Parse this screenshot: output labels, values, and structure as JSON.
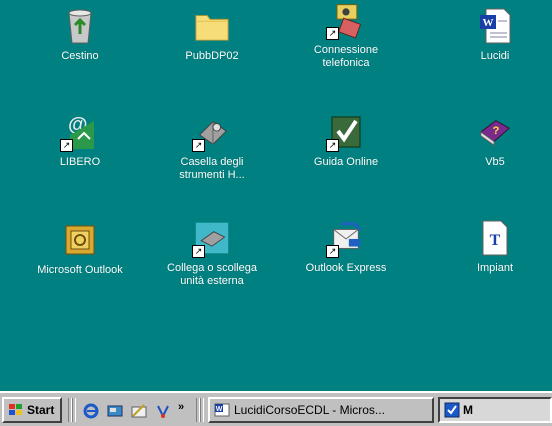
{
  "desktop": {
    "background_color": "#008080",
    "icons": [
      {
        "name": "Cestino",
        "icon": "recycle-bin-icon"
      },
      {
        "name": "PubbDP02",
        "icon": "folder-icon"
      },
      {
        "name": "Connessione telefonica",
        "icon": "dial-up-icon"
      },
      {
        "name": "Lucidi",
        "icon": "word-document-icon"
      },
      {
        "name": "LIBERO",
        "icon": "libero-icon"
      },
      {
        "name": "Casella degli strumenti H...",
        "icon": "toolbox-icon"
      },
      {
        "name": "Guida Online",
        "icon": "online-guide-icon"
      },
      {
        "name": "Vb5",
        "icon": "help-book-icon"
      },
      {
        "name": "Microsoft Outlook",
        "icon": "outlook-icon"
      },
      {
        "name": "Collega o scollega unità esterna",
        "icon": "external-drive-icon"
      },
      {
        "name": "Outlook Express",
        "icon": "outlook-express-icon"
      },
      {
        "name": "Impiant",
        "icon": "font-file-icon"
      }
    ]
  },
  "taskbar": {
    "start_label": "Start",
    "quick_launch": [
      "internet-explorer-icon",
      "show-desktop-icon",
      "outlook-express-icon",
      "channels-icon"
    ],
    "overflow": "»",
    "tasks": [
      {
        "label": "LucidiCorsoECDL - Micros...",
        "icon": "word-document-icon"
      },
      {
        "label": "M",
        "icon": "app-icon"
      }
    ]
  }
}
